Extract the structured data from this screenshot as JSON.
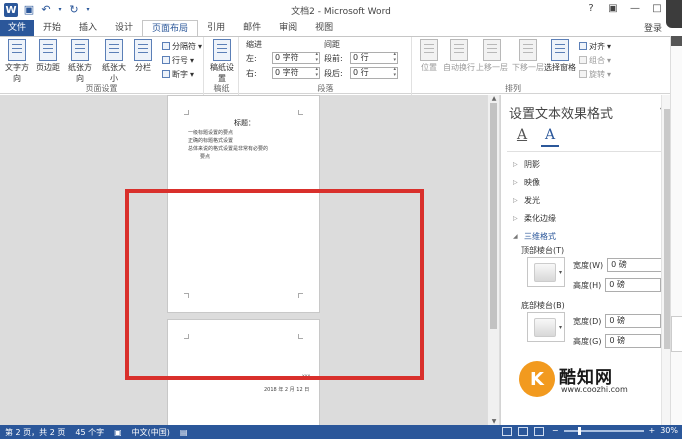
{
  "title_bar": {
    "app_icon": "W",
    "document_title": "文档2 - Microsoft Word",
    "controls": [
      "?",
      "▣",
      "—",
      "□",
      "✕"
    ]
  },
  "tabs": {
    "file": "文件",
    "items": [
      "开始",
      "插入",
      "设计",
      "页面布局",
      "引用",
      "邮件",
      "审阅",
      "视图"
    ],
    "active_index": 3,
    "login": "登录"
  },
  "ribbon": {
    "page_setup": {
      "label": "页面设置",
      "buttons": [
        "文字方向",
        "页边距",
        "纸张方向",
        "纸张大小",
        "分栏"
      ],
      "small": [
        "分隔符",
        "行号",
        "断字"
      ]
    },
    "manuscript": {
      "label": "稿纸",
      "button": "稿纸设置"
    },
    "paragraph": {
      "label": "段落",
      "indent_header": "缩进",
      "spacing_header": "间距",
      "indent_left_label": "左:",
      "indent_left_value": "0 字符",
      "indent_right_label": "右:",
      "indent_right_value": "0 字符",
      "spacing_before_label": "段前:",
      "spacing_before_value": "0 行",
      "spacing_after_label": "段后:",
      "spacing_after_value": "0 行"
    },
    "arrange": {
      "label": "排列",
      "buttons": [
        "位置",
        "自动换行",
        "上移一层",
        "下移一层",
        "选择窗格"
      ],
      "small": [
        "对齐",
        "组合",
        "旋转"
      ]
    }
  },
  "document": {
    "page1": {
      "heading": "标题：",
      "lines": [
        "一级标题设置的要点",
        "正确的标题格式设置",
        "总体来说的格式设置是非常有必要的",
        "要点"
      ]
    },
    "page2": {
      "sig": "XXX",
      "date": "2018 年 2 月 12 日"
    }
  },
  "pane": {
    "title": "设置文本效果格式",
    "tab_text_fill": "A",
    "tab_text_effects": "A",
    "sections": [
      "阴影",
      "映像",
      "发光",
      "柔化边缘",
      "三维格式"
    ],
    "top_bevel_label": "顶部棱台(T)",
    "bottom_bevel_label": "底部棱台(B)",
    "width_label": "宽度(W)",
    "height_label": "高度(H)",
    "width2_label": "宽度(D)",
    "height2_label": "高度(G)",
    "top_width": "0 磅",
    "top_height": "0 磅",
    "bottom_width": "0 磅",
    "bottom_height": "0 磅"
  },
  "watermark": {
    "name": "酷知网",
    "url": "www.coozhi.com"
  },
  "status": {
    "page": "第 2 页，共 2 页",
    "words": "45 个字",
    "language": "中文(中国)",
    "zoom": "30%"
  },
  "colors": {
    "accent": "#2b579a",
    "highlight": "#d9302c",
    "brand_orange": "#f29a1f"
  }
}
